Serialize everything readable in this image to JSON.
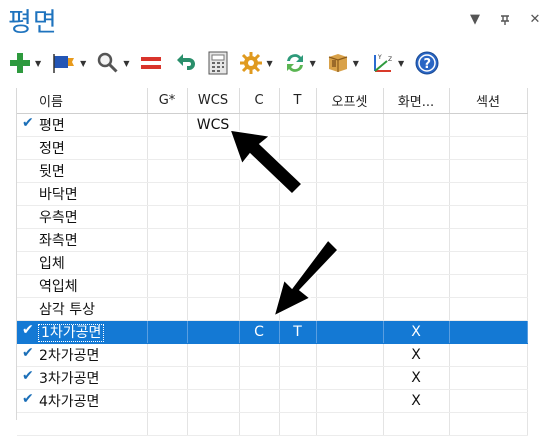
{
  "panel": {
    "title": "평면"
  },
  "window_controls": [
    "▼",
    "ᅮ",
    "✕"
  ],
  "toolbar": [
    {
      "icon": "add-icon",
      "dropdown": true
    },
    {
      "icon": "flag-icon",
      "dropdown": true
    },
    {
      "icon": "search-icon",
      "dropdown": true
    },
    {
      "icon": "equals-icon",
      "dropdown": false
    },
    {
      "icon": "undo-icon",
      "dropdown": false
    },
    {
      "icon": "calculator-icon",
      "dropdown": false
    },
    {
      "icon": "gear-icon",
      "dropdown": true
    },
    {
      "icon": "refresh-icon",
      "dropdown": true
    },
    {
      "icon": "box-icon",
      "dropdown": true
    },
    {
      "icon": "axes-icon",
      "dropdown": true
    },
    {
      "icon": "help-icon",
      "dropdown": false
    }
  ],
  "grid": {
    "columns": [
      "이름",
      "G*",
      "WCS",
      "C",
      "T",
      "오프셋",
      "화면...",
      "섹션"
    ],
    "rows": [
      {
        "check": true,
        "name": "평면",
        "g": "",
        "wcs": "WCS",
        "c": "",
        "t": "",
        "offset": "",
        "screen": "",
        "section": ""
      },
      {
        "check": false,
        "name": "정면",
        "g": "",
        "wcs": "",
        "c": "",
        "t": "",
        "offset": "",
        "screen": "",
        "section": ""
      },
      {
        "check": false,
        "name": "뒷면",
        "g": "",
        "wcs": "",
        "c": "",
        "t": "",
        "offset": "",
        "screen": "",
        "section": ""
      },
      {
        "check": false,
        "name": "바닥면",
        "g": "",
        "wcs": "",
        "c": "",
        "t": "",
        "offset": "",
        "screen": "",
        "section": ""
      },
      {
        "check": false,
        "name": "우측면",
        "g": "",
        "wcs": "",
        "c": "",
        "t": "",
        "offset": "",
        "screen": "",
        "section": ""
      },
      {
        "check": false,
        "name": "좌측면",
        "g": "",
        "wcs": "",
        "c": "",
        "t": "",
        "offset": "",
        "screen": "",
        "section": ""
      },
      {
        "check": false,
        "name": "입체",
        "g": "",
        "wcs": "",
        "c": "",
        "t": "",
        "offset": "",
        "screen": "",
        "section": ""
      },
      {
        "check": false,
        "name": "역입체",
        "g": "",
        "wcs": "",
        "c": "",
        "t": "",
        "offset": "",
        "screen": "",
        "section": ""
      },
      {
        "check": false,
        "name": "삼각 투상",
        "g": "",
        "wcs": "",
        "c": "",
        "t": "",
        "offset": "",
        "screen": "",
        "section": ""
      },
      {
        "check": true,
        "name": "1차가공면",
        "g": "",
        "wcs": "",
        "c": "C",
        "t": "T",
        "offset": "",
        "screen": "X",
        "section": "",
        "selected": true
      },
      {
        "check": true,
        "name": "2차가공면",
        "g": "",
        "wcs": "",
        "c": "",
        "t": "",
        "offset": "",
        "screen": "X",
        "section": ""
      },
      {
        "check": true,
        "name": "3차가공면",
        "g": "",
        "wcs": "",
        "c": "",
        "t": "",
        "offset": "",
        "screen": "X",
        "section": ""
      },
      {
        "check": true,
        "name": "4차가공면",
        "g": "",
        "wcs": "",
        "c": "",
        "t": "",
        "offset": "",
        "screen": "X",
        "section": ""
      },
      {
        "check": false,
        "name": "",
        "g": "",
        "wcs": "",
        "c": "",
        "t": "",
        "offset": "",
        "screen": "",
        "section": ""
      }
    ]
  },
  "colors": {
    "accent": "#1479d4",
    "title": "#1e73be",
    "check": "#1b6fb8"
  },
  "check_glyph": "✔"
}
